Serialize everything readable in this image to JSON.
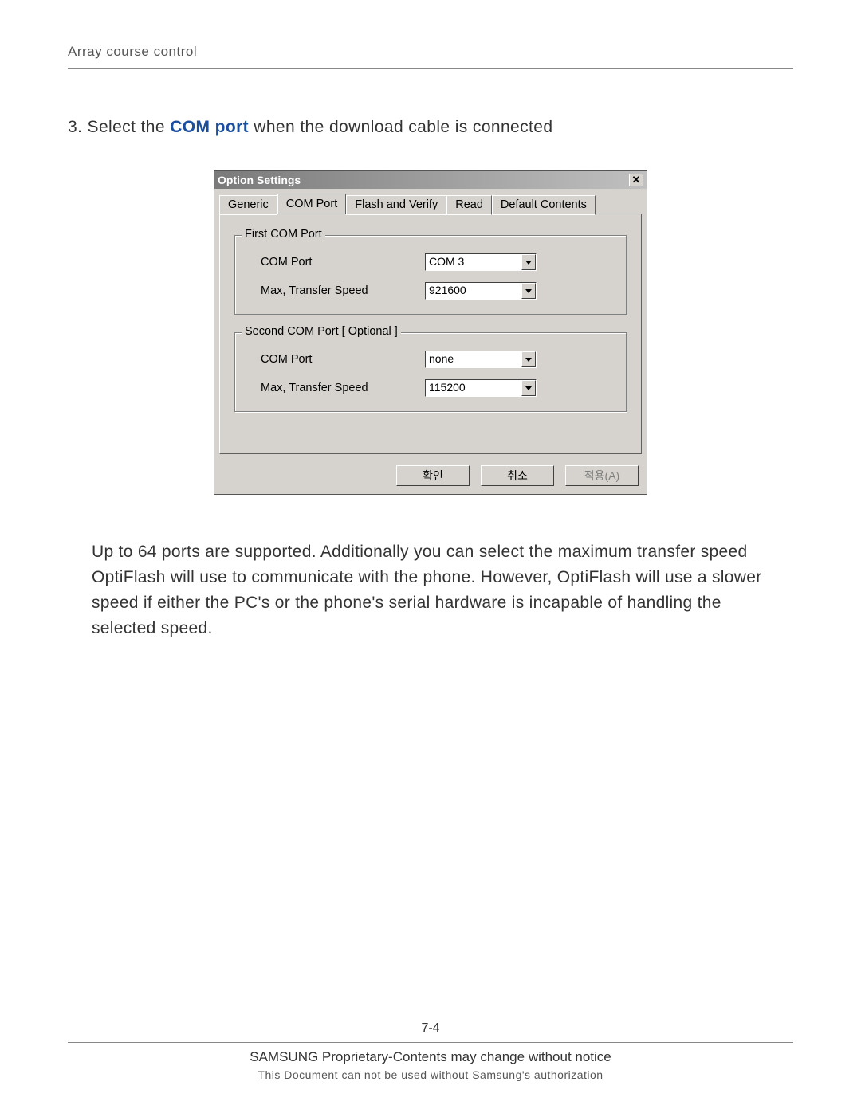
{
  "header": {
    "title": "Array course control"
  },
  "instruction": {
    "prefix": "3. Select the ",
    "emphasis": "COM port",
    "suffix": " when the download cable is connected"
  },
  "dialog": {
    "title": "Option Settings",
    "tabs": [
      "Generic",
      "COM Port",
      "Flash and Verify",
      "Read",
      "Default Contents"
    ],
    "active_tab_index": 1,
    "group1": {
      "legend": "First COM Port",
      "com_label": "COM Port",
      "com_value": "COM 3",
      "speed_label": "Max, Transfer Speed",
      "speed_value": "921600"
    },
    "group2": {
      "legend": "Second COM Port [ Optional ]",
      "com_label": "COM Port",
      "com_value": "none",
      "speed_label": "Max, Transfer Speed",
      "speed_value": "115200"
    },
    "buttons": {
      "ok": "확인",
      "cancel": "취소",
      "apply": "적용(A)"
    }
  },
  "body_text": "Up to 64 ports are supported. Additionally you can select the maximum transfer speed OptiFlash will use to communicate with the phone. However, OptiFlash will use a slower speed if either the PC's or the phone's serial hardware is incapable of handling the selected speed.",
  "footer": {
    "page_num": "7-4",
    "line1": "SAMSUNG Proprietary-Contents may change without notice",
    "line2": "This Document can not be used without Samsung's authorization"
  }
}
